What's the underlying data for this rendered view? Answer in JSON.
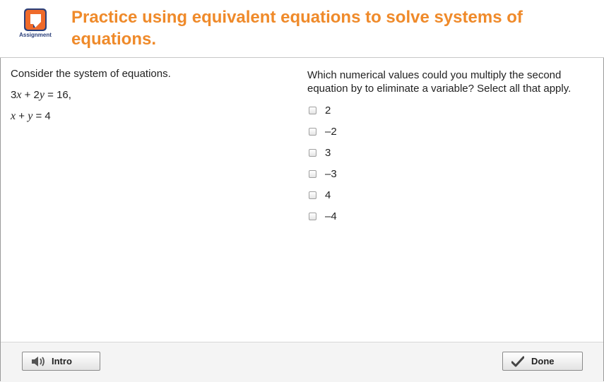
{
  "header": {
    "logo_label": "Assignment",
    "title": "Practice using equivalent equations to solve systems of equations."
  },
  "left": {
    "prompt": "Consider the system of equations.",
    "equation1": {
      "t1": "3",
      "v1": "x",
      "t2": " + 2",
      "v2": "y",
      "t3": " = 16,"
    },
    "equation2": {
      "v1": "x",
      "t1": " + ",
      "v2": "y",
      "t2": " = 4"
    }
  },
  "right": {
    "question": "Which numerical values could  you multiply the second equation by to eliminate a variable? Select all that apply.",
    "options": [
      "2",
      "–2",
      "3",
      "–3",
      "4",
      "–4"
    ]
  },
  "footer": {
    "intro_label": "Intro",
    "done_label": "Done"
  },
  "colors": {
    "title": "#ef8a2a",
    "logo_bg": "#2a3f7a",
    "logo_accent": "#ef6a2a"
  }
}
